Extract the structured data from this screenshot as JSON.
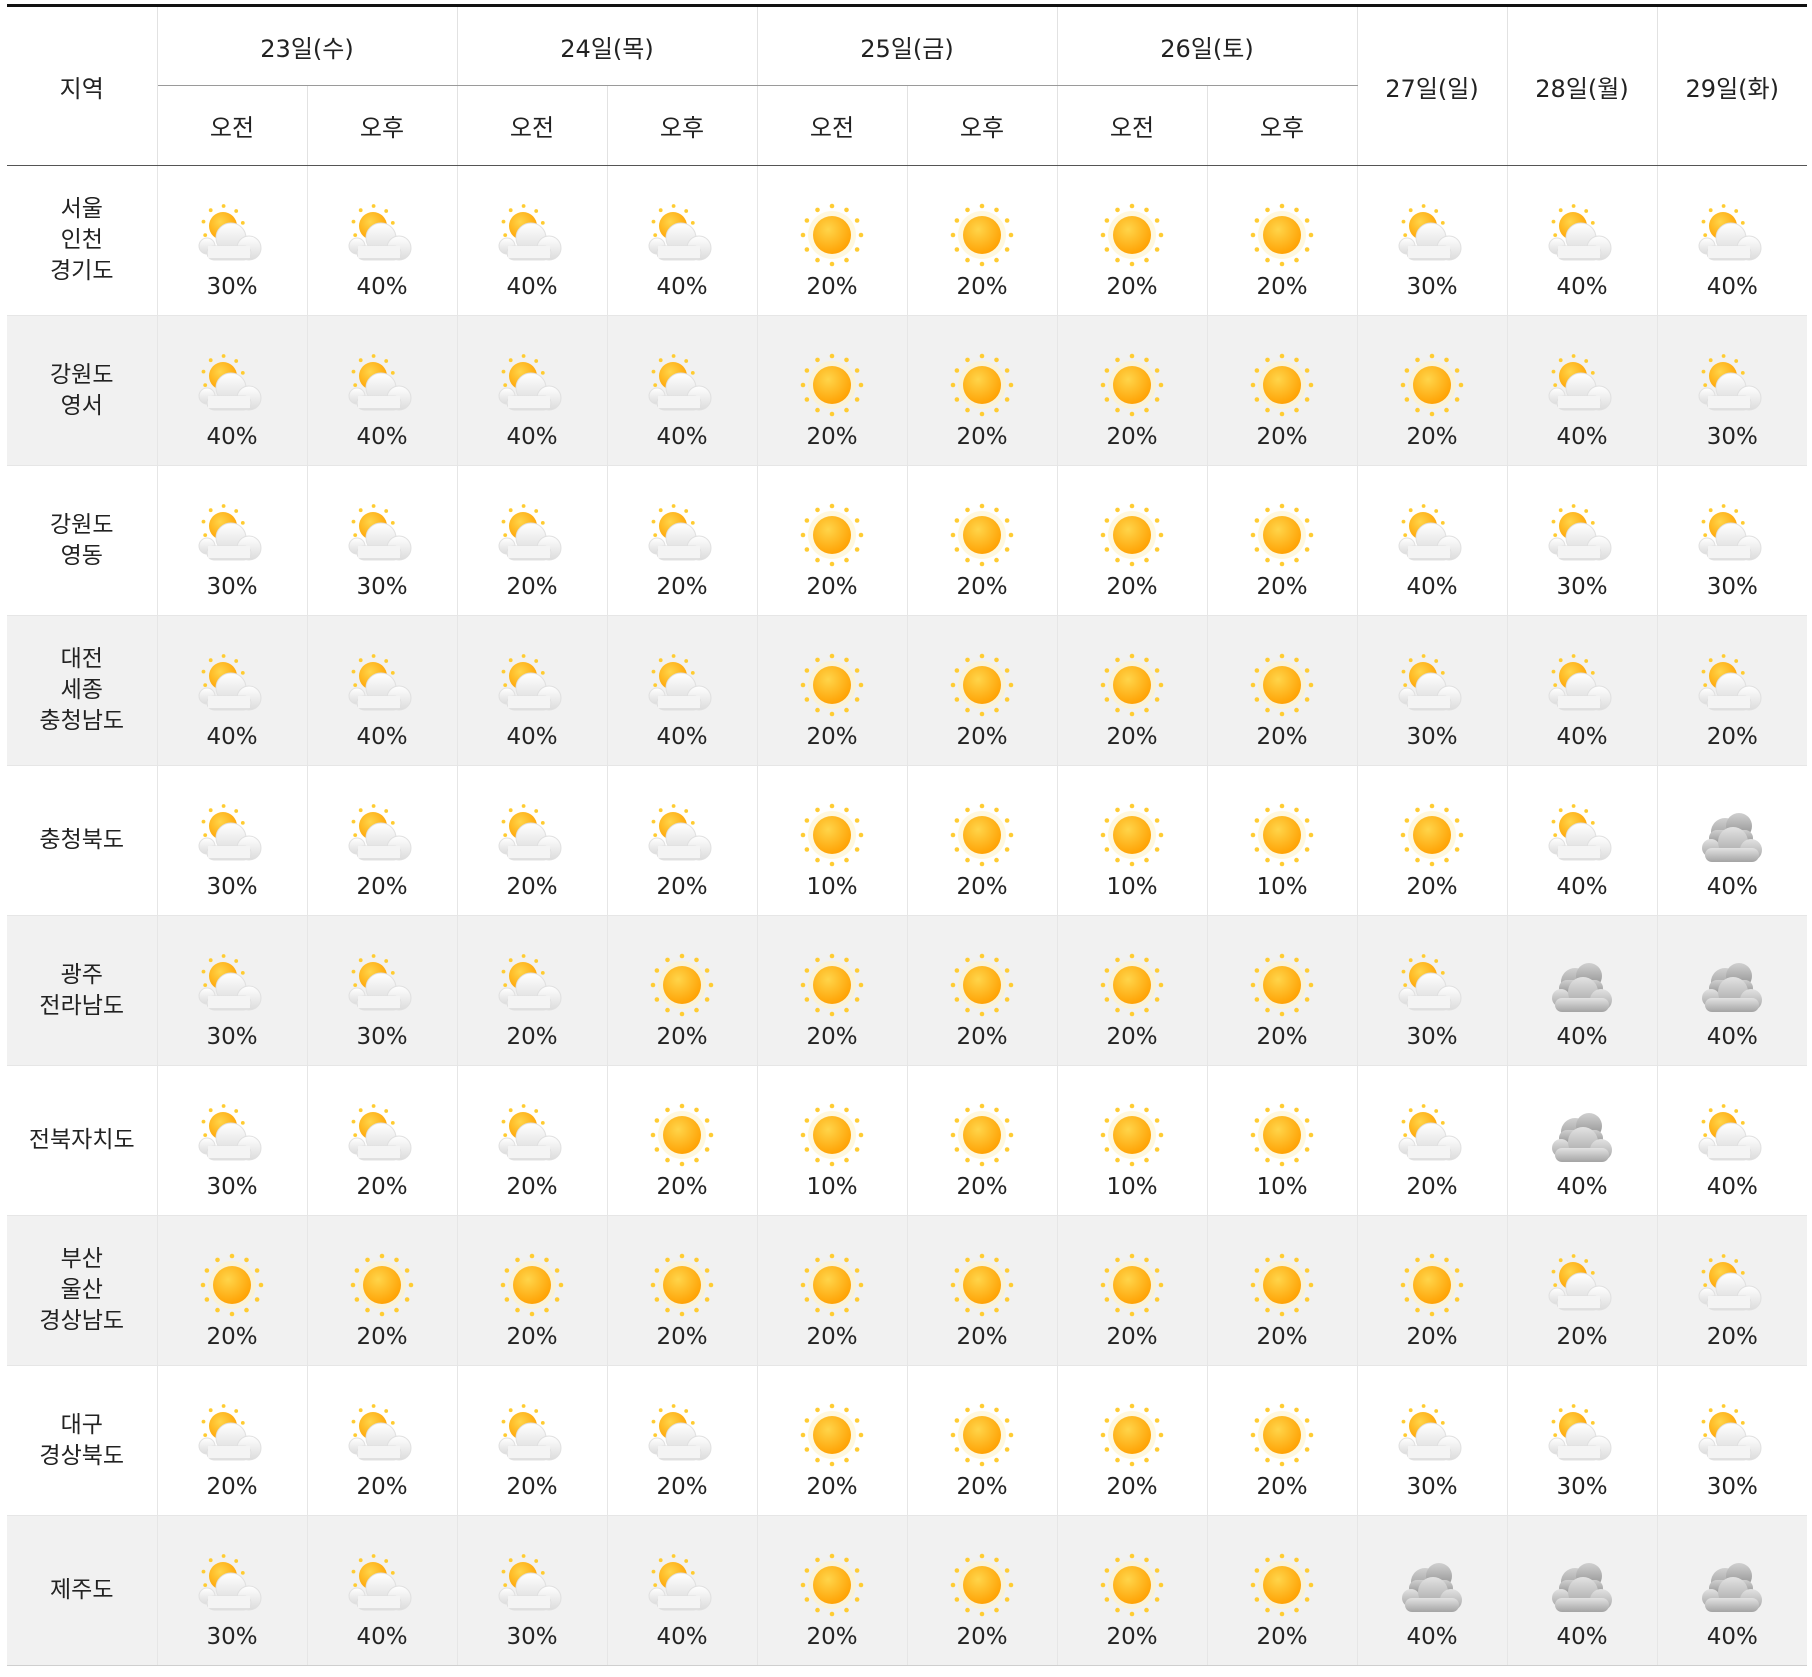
{
  "header": {
    "region_label": "지역",
    "split_dates": [
      "23일(수)",
      "24일(목)",
      "25일(금)",
      "26일(토)"
    ],
    "full_dates": [
      "27일(일)",
      "28일(월)",
      "29일(화)"
    ],
    "am_label": "오전",
    "pm_label": "오후"
  },
  "icons": {
    "sunny": "sun-icon",
    "partly_cloudy": "sun-behind-cloud-icon",
    "cloudy": "cloudy-icon"
  },
  "colors": {
    "sun": "#ffb300",
    "sun_ray": "#ffcc33",
    "cloud_light": "#f2f2f2",
    "cloud_dark": "#a8a8a8",
    "row_alt": "#f1f1f1"
  },
  "rows": [
    {
      "region": [
        "서울",
        "인천",
        "경기도"
      ],
      "cells": [
        {
          "icon": "partly_cloudy",
          "pct": "30%"
        },
        {
          "icon": "partly_cloudy",
          "pct": "40%"
        },
        {
          "icon": "partly_cloudy",
          "pct": "40%"
        },
        {
          "icon": "partly_cloudy",
          "pct": "40%"
        },
        {
          "icon": "sunny",
          "pct": "20%"
        },
        {
          "icon": "sunny",
          "pct": "20%"
        },
        {
          "icon": "sunny",
          "pct": "20%"
        },
        {
          "icon": "sunny",
          "pct": "20%"
        },
        {
          "icon": "partly_cloudy",
          "pct": "30%"
        },
        {
          "icon": "partly_cloudy",
          "pct": "40%"
        },
        {
          "icon": "partly_cloudy",
          "pct": "40%"
        }
      ]
    },
    {
      "region": [
        "강원도",
        "영서"
      ],
      "cells": [
        {
          "icon": "partly_cloudy",
          "pct": "40%"
        },
        {
          "icon": "partly_cloudy",
          "pct": "40%"
        },
        {
          "icon": "partly_cloudy",
          "pct": "40%"
        },
        {
          "icon": "partly_cloudy",
          "pct": "40%"
        },
        {
          "icon": "sunny",
          "pct": "20%"
        },
        {
          "icon": "sunny",
          "pct": "20%"
        },
        {
          "icon": "sunny",
          "pct": "20%"
        },
        {
          "icon": "sunny",
          "pct": "20%"
        },
        {
          "icon": "sunny",
          "pct": "20%"
        },
        {
          "icon": "partly_cloudy",
          "pct": "40%"
        },
        {
          "icon": "partly_cloudy",
          "pct": "30%"
        }
      ]
    },
    {
      "region": [
        "강원도",
        "영동"
      ],
      "cells": [
        {
          "icon": "partly_cloudy",
          "pct": "30%"
        },
        {
          "icon": "partly_cloudy",
          "pct": "30%"
        },
        {
          "icon": "partly_cloudy",
          "pct": "20%"
        },
        {
          "icon": "partly_cloudy",
          "pct": "20%"
        },
        {
          "icon": "sunny",
          "pct": "20%"
        },
        {
          "icon": "sunny",
          "pct": "20%"
        },
        {
          "icon": "sunny",
          "pct": "20%"
        },
        {
          "icon": "sunny",
          "pct": "20%"
        },
        {
          "icon": "partly_cloudy",
          "pct": "40%"
        },
        {
          "icon": "partly_cloudy",
          "pct": "30%"
        },
        {
          "icon": "partly_cloudy",
          "pct": "30%"
        }
      ]
    },
    {
      "region": [
        "대전",
        "세종",
        "충청남도"
      ],
      "cells": [
        {
          "icon": "partly_cloudy",
          "pct": "40%"
        },
        {
          "icon": "partly_cloudy",
          "pct": "40%"
        },
        {
          "icon": "partly_cloudy",
          "pct": "40%"
        },
        {
          "icon": "partly_cloudy",
          "pct": "40%"
        },
        {
          "icon": "sunny",
          "pct": "20%"
        },
        {
          "icon": "sunny",
          "pct": "20%"
        },
        {
          "icon": "sunny",
          "pct": "20%"
        },
        {
          "icon": "sunny",
          "pct": "20%"
        },
        {
          "icon": "partly_cloudy",
          "pct": "30%"
        },
        {
          "icon": "partly_cloudy",
          "pct": "40%"
        },
        {
          "icon": "partly_cloudy",
          "pct": "20%"
        }
      ]
    },
    {
      "region": [
        "충청북도"
      ],
      "cells": [
        {
          "icon": "partly_cloudy",
          "pct": "30%"
        },
        {
          "icon": "partly_cloudy",
          "pct": "20%"
        },
        {
          "icon": "partly_cloudy",
          "pct": "20%"
        },
        {
          "icon": "partly_cloudy",
          "pct": "20%"
        },
        {
          "icon": "sunny",
          "pct": "10%"
        },
        {
          "icon": "sunny",
          "pct": "20%"
        },
        {
          "icon": "sunny",
          "pct": "10%"
        },
        {
          "icon": "sunny",
          "pct": "10%"
        },
        {
          "icon": "sunny",
          "pct": "20%"
        },
        {
          "icon": "partly_cloudy",
          "pct": "40%"
        },
        {
          "icon": "cloudy",
          "pct": "40%"
        }
      ]
    },
    {
      "region": [
        "광주",
        "전라남도"
      ],
      "cells": [
        {
          "icon": "partly_cloudy",
          "pct": "30%"
        },
        {
          "icon": "partly_cloudy",
          "pct": "30%"
        },
        {
          "icon": "partly_cloudy",
          "pct": "20%"
        },
        {
          "icon": "sunny",
          "pct": "20%"
        },
        {
          "icon": "sunny",
          "pct": "20%"
        },
        {
          "icon": "sunny",
          "pct": "20%"
        },
        {
          "icon": "sunny",
          "pct": "20%"
        },
        {
          "icon": "sunny",
          "pct": "20%"
        },
        {
          "icon": "partly_cloudy",
          "pct": "30%"
        },
        {
          "icon": "cloudy",
          "pct": "40%"
        },
        {
          "icon": "cloudy",
          "pct": "40%"
        }
      ]
    },
    {
      "region": [
        "전북자치도"
      ],
      "cells": [
        {
          "icon": "partly_cloudy",
          "pct": "30%"
        },
        {
          "icon": "partly_cloudy",
          "pct": "20%"
        },
        {
          "icon": "partly_cloudy",
          "pct": "20%"
        },
        {
          "icon": "sunny",
          "pct": "20%"
        },
        {
          "icon": "sunny",
          "pct": "10%"
        },
        {
          "icon": "sunny",
          "pct": "20%"
        },
        {
          "icon": "sunny",
          "pct": "10%"
        },
        {
          "icon": "sunny",
          "pct": "10%"
        },
        {
          "icon": "partly_cloudy",
          "pct": "20%"
        },
        {
          "icon": "cloudy",
          "pct": "40%"
        },
        {
          "icon": "partly_cloudy",
          "pct": "40%"
        }
      ]
    },
    {
      "region": [
        "부산",
        "울산",
        "경상남도"
      ],
      "cells": [
        {
          "icon": "sunny",
          "pct": "20%"
        },
        {
          "icon": "sunny",
          "pct": "20%"
        },
        {
          "icon": "sunny",
          "pct": "20%"
        },
        {
          "icon": "sunny",
          "pct": "20%"
        },
        {
          "icon": "sunny",
          "pct": "20%"
        },
        {
          "icon": "sunny",
          "pct": "20%"
        },
        {
          "icon": "sunny",
          "pct": "20%"
        },
        {
          "icon": "sunny",
          "pct": "20%"
        },
        {
          "icon": "sunny",
          "pct": "20%"
        },
        {
          "icon": "partly_cloudy",
          "pct": "20%"
        },
        {
          "icon": "partly_cloudy",
          "pct": "20%"
        }
      ]
    },
    {
      "region": [
        "대구",
        "경상북도"
      ],
      "cells": [
        {
          "icon": "partly_cloudy",
          "pct": "20%"
        },
        {
          "icon": "partly_cloudy",
          "pct": "20%"
        },
        {
          "icon": "partly_cloudy",
          "pct": "20%"
        },
        {
          "icon": "partly_cloudy",
          "pct": "20%"
        },
        {
          "icon": "sunny",
          "pct": "20%"
        },
        {
          "icon": "sunny",
          "pct": "20%"
        },
        {
          "icon": "sunny",
          "pct": "20%"
        },
        {
          "icon": "sunny",
          "pct": "20%"
        },
        {
          "icon": "partly_cloudy",
          "pct": "30%"
        },
        {
          "icon": "partly_cloudy",
          "pct": "30%"
        },
        {
          "icon": "partly_cloudy",
          "pct": "30%"
        }
      ]
    },
    {
      "region": [
        "제주도"
      ],
      "cells": [
        {
          "icon": "partly_cloudy",
          "pct": "30%"
        },
        {
          "icon": "partly_cloudy",
          "pct": "40%"
        },
        {
          "icon": "partly_cloudy",
          "pct": "30%"
        },
        {
          "icon": "partly_cloudy",
          "pct": "40%"
        },
        {
          "icon": "sunny",
          "pct": "20%"
        },
        {
          "icon": "sunny",
          "pct": "20%"
        },
        {
          "icon": "sunny",
          "pct": "20%"
        },
        {
          "icon": "sunny",
          "pct": "20%"
        },
        {
          "icon": "cloudy",
          "pct": "40%"
        },
        {
          "icon": "cloudy",
          "pct": "40%"
        },
        {
          "icon": "cloudy",
          "pct": "40%"
        }
      ]
    }
  ]
}
